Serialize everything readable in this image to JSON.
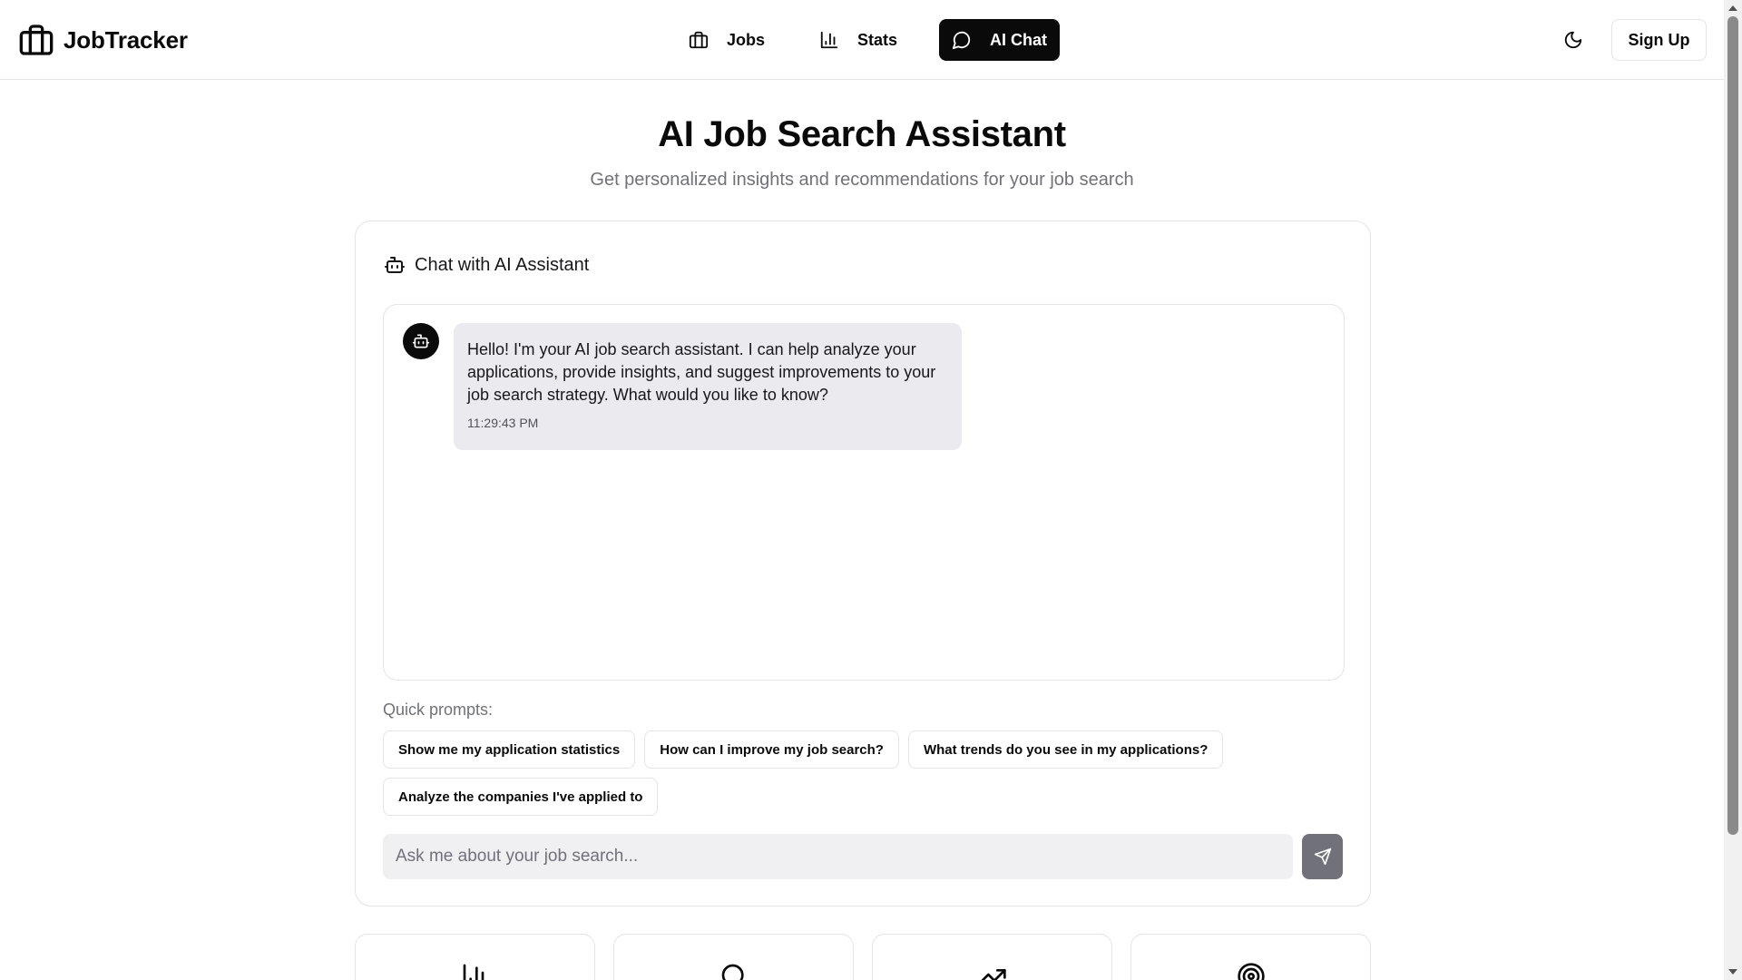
{
  "header": {
    "brand_name": "JobTracker",
    "nav": [
      {
        "label": "Jobs",
        "icon": "briefcase-icon",
        "active": false
      },
      {
        "label": "Stats",
        "icon": "bar-chart-icon",
        "active": false
      },
      {
        "label": "AI Chat",
        "icon": "message-circle-icon",
        "active": true
      }
    ],
    "theme_toggle_icon": "moon-icon",
    "signup_label": "Sign Up"
  },
  "hero": {
    "title": "AI Job Search Assistant",
    "subtitle": "Get personalized insights and recommendations for your job search"
  },
  "chat": {
    "card_title": "Chat with AI Assistant",
    "messages": [
      {
        "sender": "assistant",
        "text": "Hello! I'm your AI job search assistant. I can help analyze your applications, provide insights, and suggest improvements to your job search strategy. What would you like to know?",
        "time": "11:29:43 PM"
      }
    ],
    "quick_prompts_label": "Quick prompts:",
    "quick_prompts": [
      "Show me my application statistics",
      "How can I improve my job search?",
      "What trends do you see in my applications?",
      "Analyze the companies I've applied to"
    ],
    "input_placeholder": "Ask me about your job search...",
    "input_value": ""
  },
  "feature_cards": [
    {
      "icon": "bar-chart-icon"
    },
    {
      "icon": "search-icon"
    },
    {
      "icon": "trending-up-icon"
    },
    {
      "icon": "target-icon"
    }
  ],
  "colors": {
    "primary": "#0a0a0a",
    "border": "#e4e4e7",
    "muted_text": "#71717a",
    "bubble_bg": "#ebebef",
    "input_bg": "#f0f0f2",
    "send_button": "#71717a"
  }
}
